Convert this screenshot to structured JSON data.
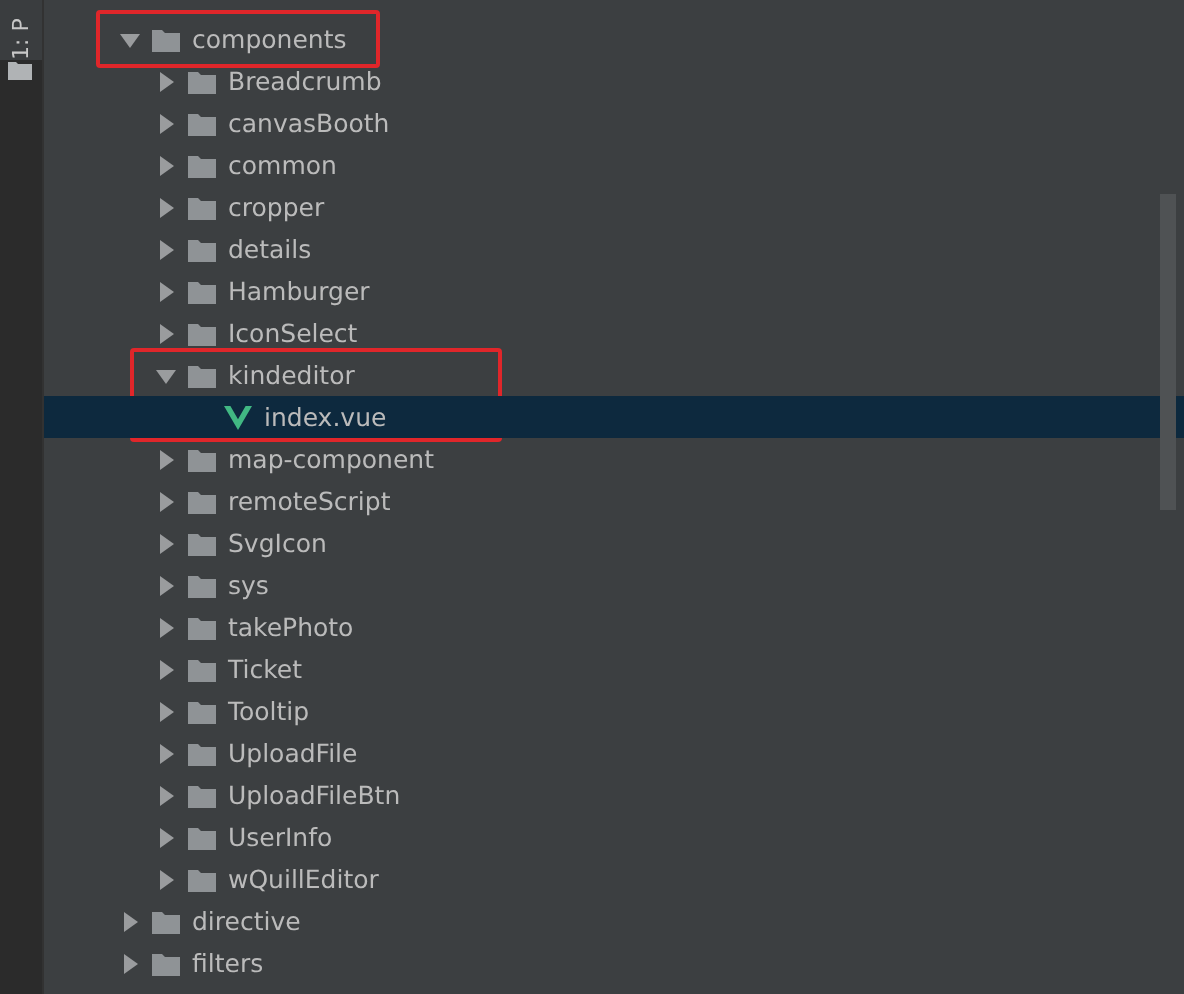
{
  "side_tab": {
    "label": "1: P",
    "selected": true
  },
  "tree": [
    {
      "name": "components",
      "kind": "folder",
      "expanded": true,
      "selected": false,
      "highlighted": true,
      "highlight_includes_children": false,
      "children": [
        {
          "name": "Breadcrumb",
          "kind": "folder",
          "expanded": false,
          "selected": false
        },
        {
          "name": "canvasBooth",
          "kind": "folder",
          "expanded": false,
          "selected": false
        },
        {
          "name": "common",
          "kind": "folder",
          "expanded": false,
          "selected": false
        },
        {
          "name": "cropper",
          "kind": "folder",
          "expanded": false,
          "selected": false
        },
        {
          "name": "details",
          "kind": "folder",
          "expanded": false,
          "selected": false
        },
        {
          "name": "Hamburger",
          "kind": "folder",
          "expanded": false,
          "selected": false
        },
        {
          "name": "IconSelect",
          "kind": "folder",
          "expanded": false,
          "selected": false
        },
        {
          "name": "kindeditor",
          "kind": "folder",
          "expanded": true,
          "selected": false,
          "highlighted": true,
          "highlight_includes_children": true,
          "children": [
            {
              "name": "index.vue",
              "kind": "vue_file",
              "selected": true
            }
          ]
        },
        {
          "name": "map-component",
          "kind": "folder",
          "expanded": false,
          "selected": false
        },
        {
          "name": "remoteScript",
          "kind": "folder",
          "expanded": false,
          "selected": false
        },
        {
          "name": "SvgIcon",
          "kind": "folder",
          "expanded": false,
          "selected": false
        },
        {
          "name": "sys",
          "kind": "folder",
          "expanded": false,
          "selected": false
        },
        {
          "name": "takePhoto",
          "kind": "folder",
          "expanded": false,
          "selected": false
        },
        {
          "name": "Ticket",
          "kind": "folder",
          "expanded": false,
          "selected": false
        },
        {
          "name": "Tooltip",
          "kind": "folder",
          "expanded": false,
          "selected": false
        },
        {
          "name": "UploadFile",
          "kind": "folder",
          "expanded": false,
          "selected": false
        },
        {
          "name": "UploadFileBtn",
          "kind": "folder",
          "expanded": false,
          "selected": false
        },
        {
          "name": "UserInfo",
          "kind": "folder",
          "expanded": false,
          "selected": false
        },
        {
          "name": "wQuillEditor",
          "kind": "folder",
          "expanded": false,
          "selected": false
        }
      ]
    },
    {
      "name": "directive",
      "kind": "folder",
      "expanded": false,
      "selected": false
    },
    {
      "name": "filters",
      "kind": "folder",
      "expanded": false,
      "selected": false
    }
  ]
}
